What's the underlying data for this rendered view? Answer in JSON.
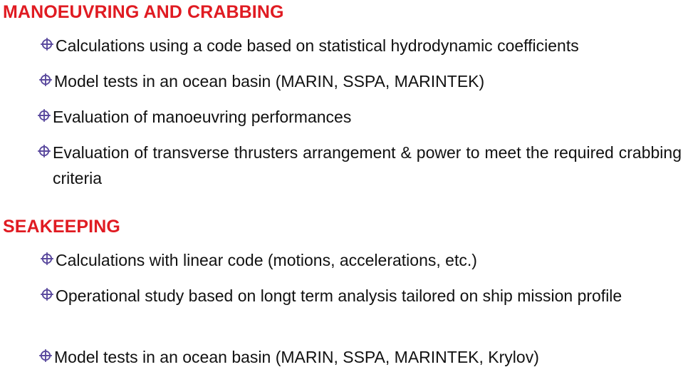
{
  "slide": {
    "background_color": "#ffffff",
    "heading_color": "#E01B22",
    "bullet_color": "#5B4A9E",
    "body_text_color": "#111111",
    "bullet_icon_name": "crosshair-bullet-icon"
  },
  "sections": [
    {
      "id": "manoeuvring",
      "heading": "MANOEUVRING AND CRABBING",
      "bullets": [
        "Calculations using a code based on statistical hydrodynamic coefficients",
        "Model tests in an ocean basin (MARIN, SSPA, MARINTEK)",
        "Evaluation of manoeuvring performances",
        "Evaluation of transverse thrusters arrangement & power to meet the required crabbing criteria"
      ]
    },
    {
      "id": "seakeeping",
      "heading": "SEAKEEPING",
      "bullets": [
        "Calculations with linear code (motions, accelerations, etc.)",
        "Operational study based on longt term analysis tailored on ship mission profile",
        "Model tests in an ocean basin (MARIN, SSPA, MARINTEK, Krylov)"
      ]
    }
  ]
}
